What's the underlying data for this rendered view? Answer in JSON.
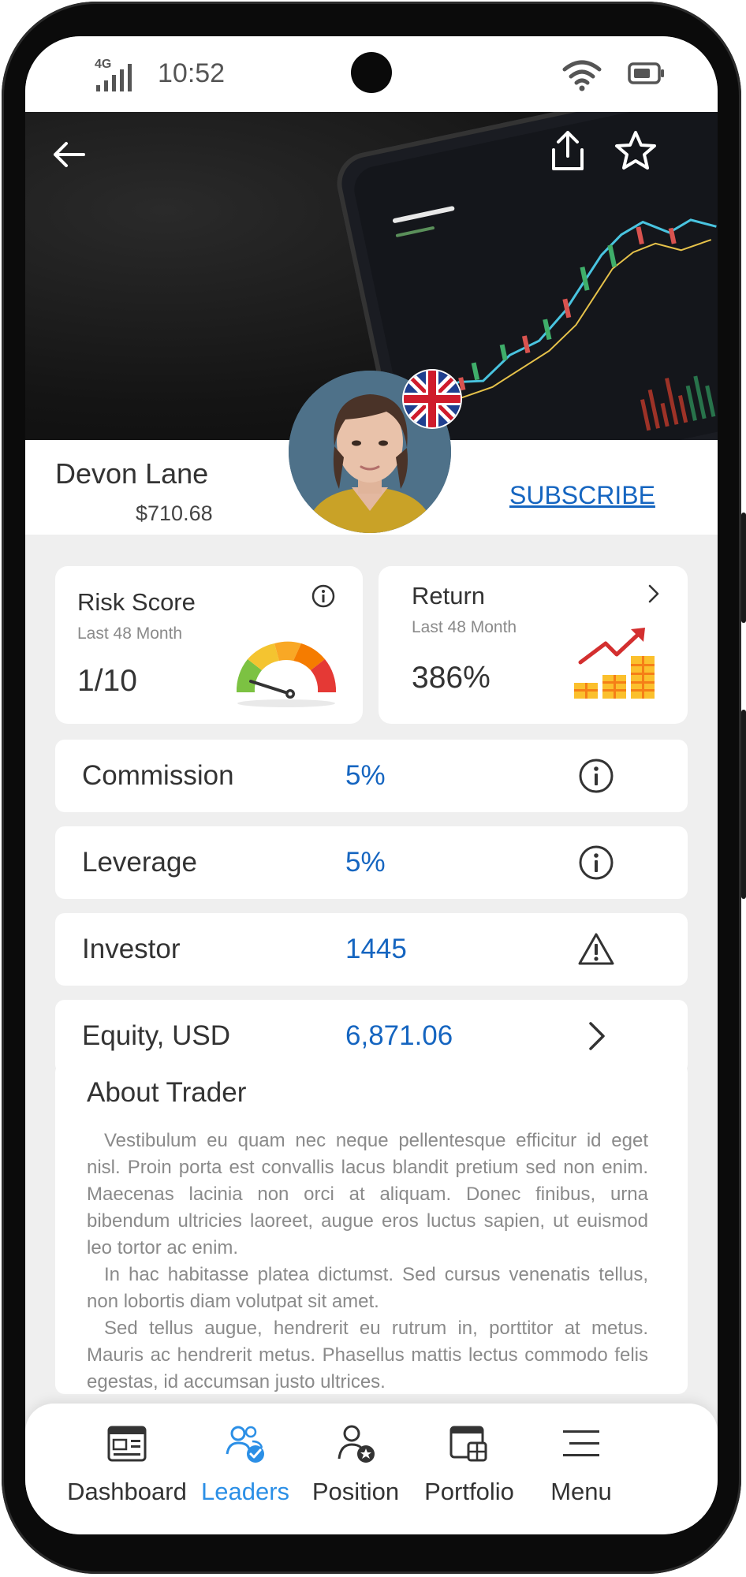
{
  "status_bar": {
    "time": "10:52",
    "network": "4G"
  },
  "hero": {
    "icons": [
      "back-arrow-icon",
      "share-icon",
      "star-icon"
    ]
  },
  "trader": {
    "name": "Devon Lane",
    "balance": "$710.68",
    "subscribe_label": "SUBSCRIBE",
    "country_flag": "united-kingdom-flag"
  },
  "risk_card": {
    "title": "Risk Score",
    "period": "Last 48 Month",
    "score": "1/10",
    "gauge_level": 0.1
  },
  "return_card": {
    "title": "Return",
    "period": "Last 48 Month",
    "value": "386%"
  },
  "stats": [
    {
      "label": "Commission",
      "value": "5%",
      "icon": "info-icon"
    },
    {
      "label": "Leverage",
      "value": "5%",
      "icon": "info-icon"
    },
    {
      "label": "Investor",
      "value": "1445",
      "icon": "warning-icon"
    },
    {
      "label": "Equity, USD",
      "value": "6,871.06",
      "icon": "chevron-right-icon"
    }
  ],
  "about": {
    "title": "About Trader",
    "paragraphs": [
      "Vestibulum eu quam nec neque pellentesque efficitur id eget nisl. Proin porta est convallis lacus blandit pretium sed non enim. Maecenas lacinia non orci at aliquam. Donec finibus, urna bibendum ultricies laoreet, augue eros luctus sapien, ut euismod leo tortor ac enim.",
      "In hac habitasse platea dictumst. Sed cursus venenatis tellus, non lobortis diam volutpat sit amet.",
      "Sed tellus augue, hendrerit eu rutrum in, porttitor at metus. Mauris ac hendrerit metus. Phasellus mattis lectus commodo felis egestas, id accumsan justo ultrices."
    ]
  },
  "nav": {
    "active": "Leaders",
    "items": [
      {
        "label": "Dashboard",
        "icon": "dashboard-icon"
      },
      {
        "label": "Leaders",
        "icon": "leaders-icon"
      },
      {
        "label": "Position",
        "icon": "position-icon"
      },
      {
        "label": "Portfolio",
        "icon": "portfolio-icon"
      },
      {
        "label": "Menu",
        "icon": "menu-icon"
      }
    ]
  },
  "colors": {
    "accent": "#1565c0",
    "nav_active": "#2b8fe6",
    "background": "#efefef"
  }
}
